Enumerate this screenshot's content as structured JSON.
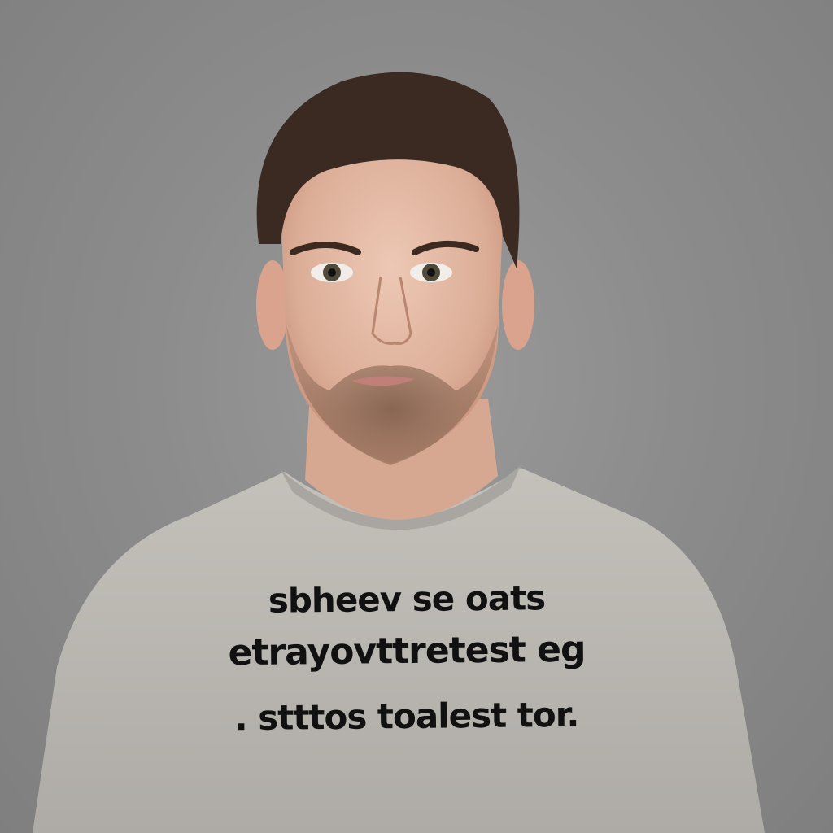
{
  "photo": {
    "subject": "man-in-grey-tshirt-portrait",
    "colors": {
      "background": "#8c8c8c",
      "skin": "#e3b9a4",
      "hair": "#3a2a22",
      "beard": "#6b4e3e",
      "shirt": "#bdbab5",
      "text": "#111111"
    }
  },
  "shirt_print": {
    "line1": "sbheev se oats",
    "line2": "etrayovttretest eg",
    "line3": ". stttos toalest tor."
  }
}
